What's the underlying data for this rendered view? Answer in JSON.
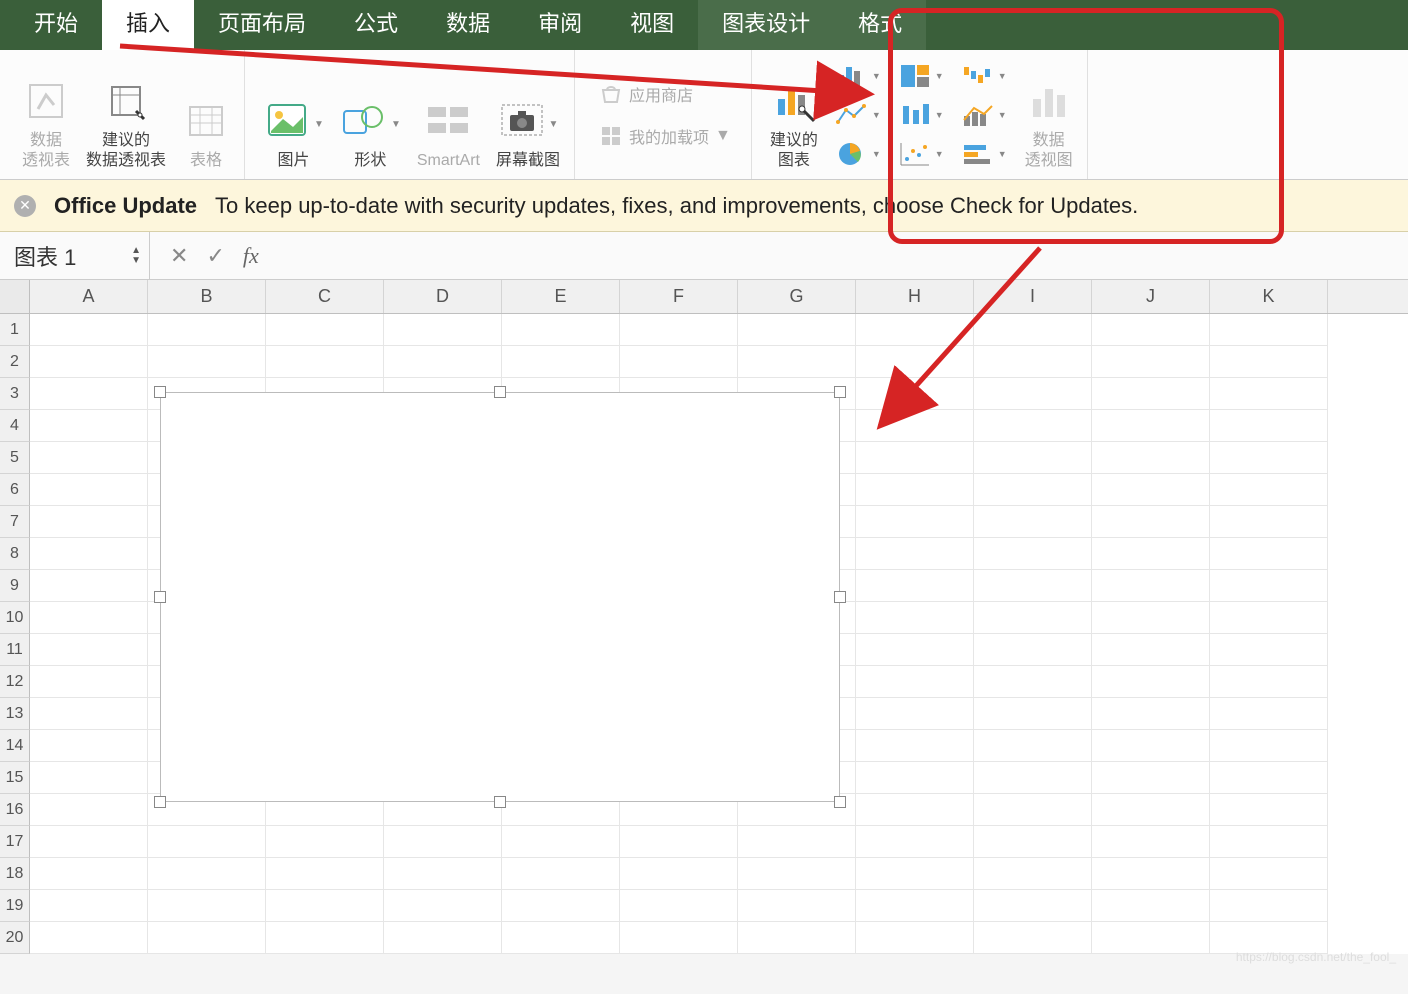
{
  "tabs": {
    "home": "开始",
    "insert": "插入",
    "layout": "页面布局",
    "formulas": "公式",
    "data": "数据",
    "review": "审阅",
    "view": "视图",
    "chartDesign": "图表设计",
    "format": "格式"
  },
  "ribbon": {
    "pivotTable": "数据\n透视表",
    "recPivot": "建议的\n数据透视表",
    "table": "表格",
    "picture": "图片",
    "shapes": "形状",
    "smartart": "SmartArt",
    "screenshot": "屏幕截图",
    "appStore": "应用商店",
    "myAddins": "我的加载项",
    "recChart": "建议的\n图表",
    "pivotChart": "数据\n透视图"
  },
  "update": {
    "title": "Office Update",
    "text": "To keep up-to-date with security updates, fixes, and improvements, choose Check for Updates."
  },
  "nameBox": "图表 1",
  "fxLabel": "fx",
  "columns": [
    "A",
    "B",
    "C",
    "D",
    "E",
    "F",
    "G",
    "H",
    "I",
    "J",
    "K"
  ],
  "rows": [
    "1",
    "2",
    "3",
    "4",
    "5",
    "6",
    "7",
    "8",
    "9",
    "10",
    "11",
    "12",
    "13",
    "14",
    "15",
    "16",
    "17",
    "18",
    "19",
    "20"
  ],
  "watermark": "https://blog.csdn.net/the_fool_"
}
